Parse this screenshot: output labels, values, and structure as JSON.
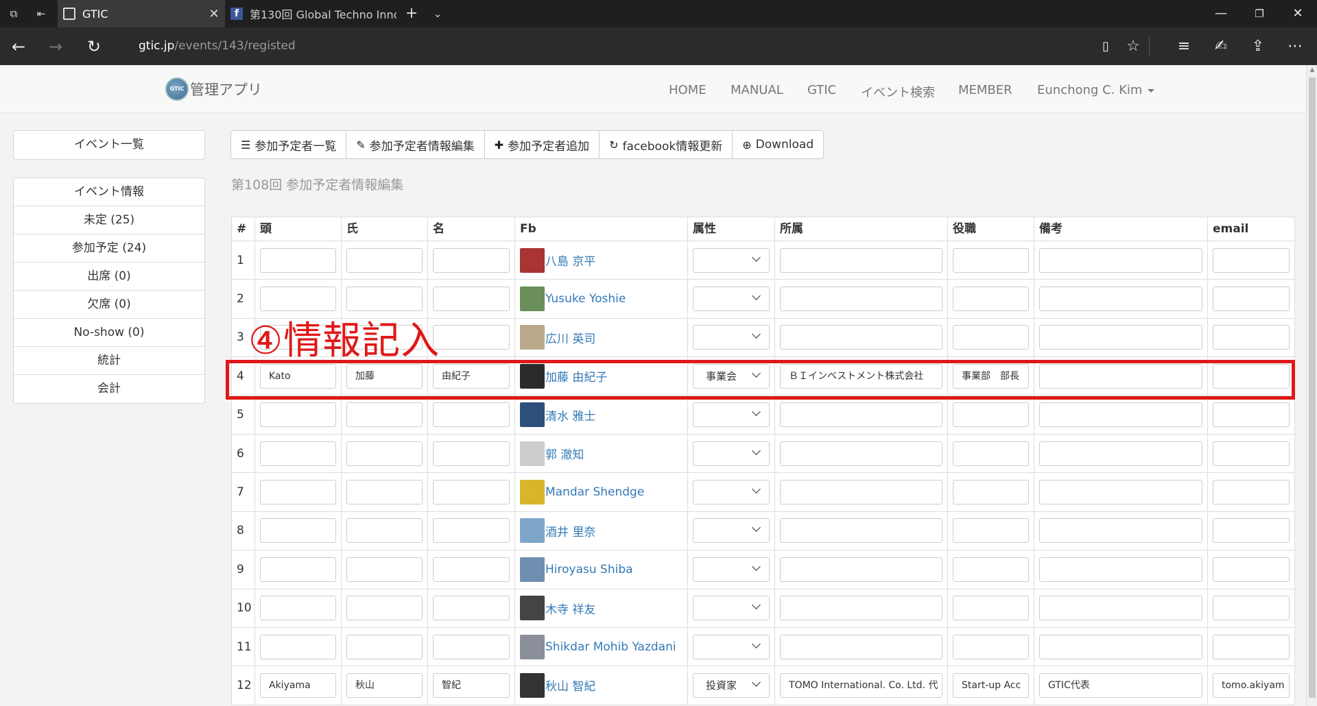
{
  "browser": {
    "tabs": [
      {
        "title": "GTIC",
        "active": true
      },
      {
        "title": "第130回 Global Techno Innc",
        "active": false
      }
    ],
    "url_host": "gtic.jp",
    "url_path": "/events/143/registed"
  },
  "site": {
    "brand": "管理アプリ",
    "logo_text": "GTIC",
    "menu": [
      "HOME",
      "MANUAL",
      "GTIC",
      "イベント検索",
      "MEMBER",
      "Eunchong C. Kim"
    ]
  },
  "sidebar": {
    "top": "イベント一覧",
    "items": [
      "イベント情報",
      "未定 (25)",
      "参加予定 (24)",
      "出席 (0)",
      "欠席 (0)",
      "No-show (0)",
      "統計",
      "会計"
    ]
  },
  "toolbar": [
    {
      "icon": "list-icon",
      "glyph": "☰",
      "label": "参加予定者一覧"
    },
    {
      "icon": "edit-icon",
      "glyph": "✎",
      "label": "参加予定者情報編集"
    },
    {
      "icon": "plus-icon",
      "glyph": "✚",
      "label": "参加予定者追加"
    },
    {
      "icon": "refresh-icon",
      "glyph": "↻",
      "label": "facebook情報更新"
    },
    {
      "icon": "download-icon",
      "glyph": "⊕",
      "label": "Download"
    }
  ],
  "subtitle": "第108回 参加予定者情報編集",
  "annotation": "④情報記入",
  "table": {
    "headers": [
      "#",
      "頭",
      "氏",
      "名",
      "Fb",
      "属性",
      "所属",
      "役職",
      "備考",
      "email"
    ],
    "rows": [
      {
        "n": "1",
        "head": "",
        "sei": "",
        "mei": "",
        "fb": "八島 京平",
        "attr": "",
        "org": "",
        "role": "",
        "note": "",
        "email": "",
        "avatar": "#a33"
      },
      {
        "n": "2",
        "head": "",
        "sei": "",
        "mei": "",
        "fb": "Yusuke Yoshie",
        "attr": "",
        "org": "",
        "role": "",
        "note": "",
        "email": "",
        "avatar": "#6a8f5a"
      },
      {
        "n": "3",
        "head": "",
        "sei": "",
        "mei": "",
        "fb": "広川 英司",
        "attr": "",
        "org": "",
        "role": "",
        "note": "",
        "email": "",
        "avatar": "#b9a98a"
      },
      {
        "n": "4",
        "head": "Kato",
        "sei": "加藤",
        "mei": "由紀子",
        "fb": "加藤 由紀子",
        "attr": "事業会",
        "org": "ＢＩインベストメント株式会社",
        "role": "事業部　部長",
        "note": "",
        "email": "",
        "avatar": "#2b2b2b"
      },
      {
        "n": "5",
        "head": "",
        "sei": "",
        "mei": "",
        "fb": "清水 雅士",
        "attr": "",
        "org": "",
        "role": "",
        "note": "",
        "email": "",
        "avatar": "#2d4f7a"
      },
      {
        "n": "6",
        "head": "",
        "sei": "",
        "mei": "",
        "fb": "郭 澈知",
        "attr": "",
        "org": "",
        "role": "",
        "note": "",
        "email": "",
        "avatar": "#ccc"
      },
      {
        "n": "7",
        "head": "",
        "sei": "",
        "mei": "",
        "fb": "Mandar Shendge",
        "attr": "",
        "org": "",
        "role": "",
        "note": "",
        "email": "",
        "avatar": "#d8b52a"
      },
      {
        "n": "8",
        "head": "",
        "sei": "",
        "mei": "",
        "fb": "酒井 里奈",
        "attr": "",
        "org": "",
        "role": "",
        "note": "",
        "email": "",
        "avatar": "#7ea6c9"
      },
      {
        "n": "9",
        "head": "",
        "sei": "",
        "mei": "",
        "fb": "Hiroyasu Shiba",
        "attr": "",
        "org": "",
        "role": "",
        "note": "",
        "email": "",
        "avatar": "#6f8fb0"
      },
      {
        "n": "10",
        "head": "",
        "sei": "",
        "mei": "",
        "fb": "木寺 祥友",
        "attr": "",
        "org": "",
        "role": "",
        "note": "",
        "email": "",
        "avatar": "#444"
      },
      {
        "n": "11",
        "head": "",
        "sei": "",
        "mei": "",
        "fb": "Shikdar Mohib Yazdani",
        "attr": "",
        "org": "",
        "role": "",
        "note": "",
        "email": "",
        "avatar": "#8a8f9a"
      },
      {
        "n": "12",
        "head": "Akiyama",
        "sei": "秋山",
        "mei": "智紀",
        "fb": "秋山 智紀",
        "attr": "投資家",
        "org": "TOMO International. Co. Ltd. 代",
        "role": "Start-up Acc",
        "note": "GTIC代表",
        "email": "tomo.akiyam",
        "avatar": "#333"
      }
    ]
  }
}
